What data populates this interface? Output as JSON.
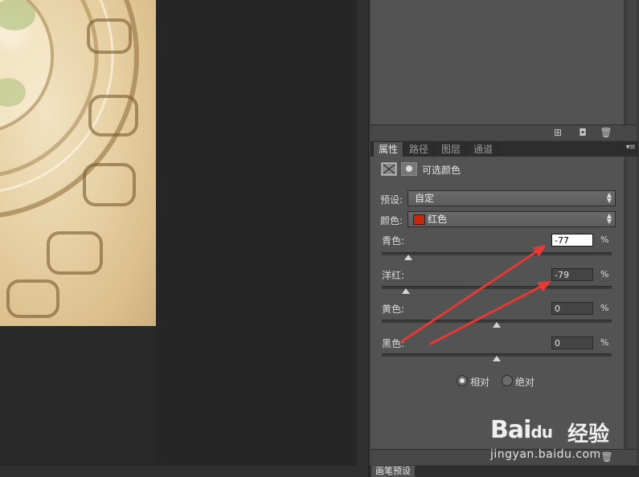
{
  "top_panel": {
    "icons": [
      "new-layer-icon",
      "camera-icon",
      "trash-icon"
    ]
  },
  "panel_tabs": [
    {
      "label": "属性",
      "active": true
    },
    {
      "label": "路径",
      "active": false
    },
    {
      "label": "图层",
      "active": false
    },
    {
      "label": "通道",
      "active": false
    }
  ],
  "adjustment": {
    "title": "可选颜色"
  },
  "preset": {
    "label": "预设:",
    "value": "自定"
  },
  "colors": {
    "label": "颜色:",
    "value": "红色",
    "swatch": "#c52a0e"
  },
  "sliders": [
    {
      "label": "青色:",
      "value": "-77",
      "unit": "%",
      "level": -77
    },
    {
      "label": "洋红:",
      "value": "-79",
      "unit": "%",
      "level": -79
    },
    {
      "label": "黄色:",
      "value": "0",
      "unit": "%",
      "level": 0
    },
    {
      "label": "黑色:",
      "value": "0",
      "unit": "%",
      "level": 0
    }
  ],
  "method": {
    "options": [
      {
        "label": "相对",
        "selected": true
      },
      {
        "label": "绝对",
        "selected": false
      }
    ]
  },
  "bottom_panel": {
    "tab": "画笔预设"
  },
  "watermark": {
    "brand": "Bai",
    "brand2": "du",
    "cn": "经验",
    "url": "jingyan.baidu.com"
  },
  "annotation_color": "#e53935"
}
